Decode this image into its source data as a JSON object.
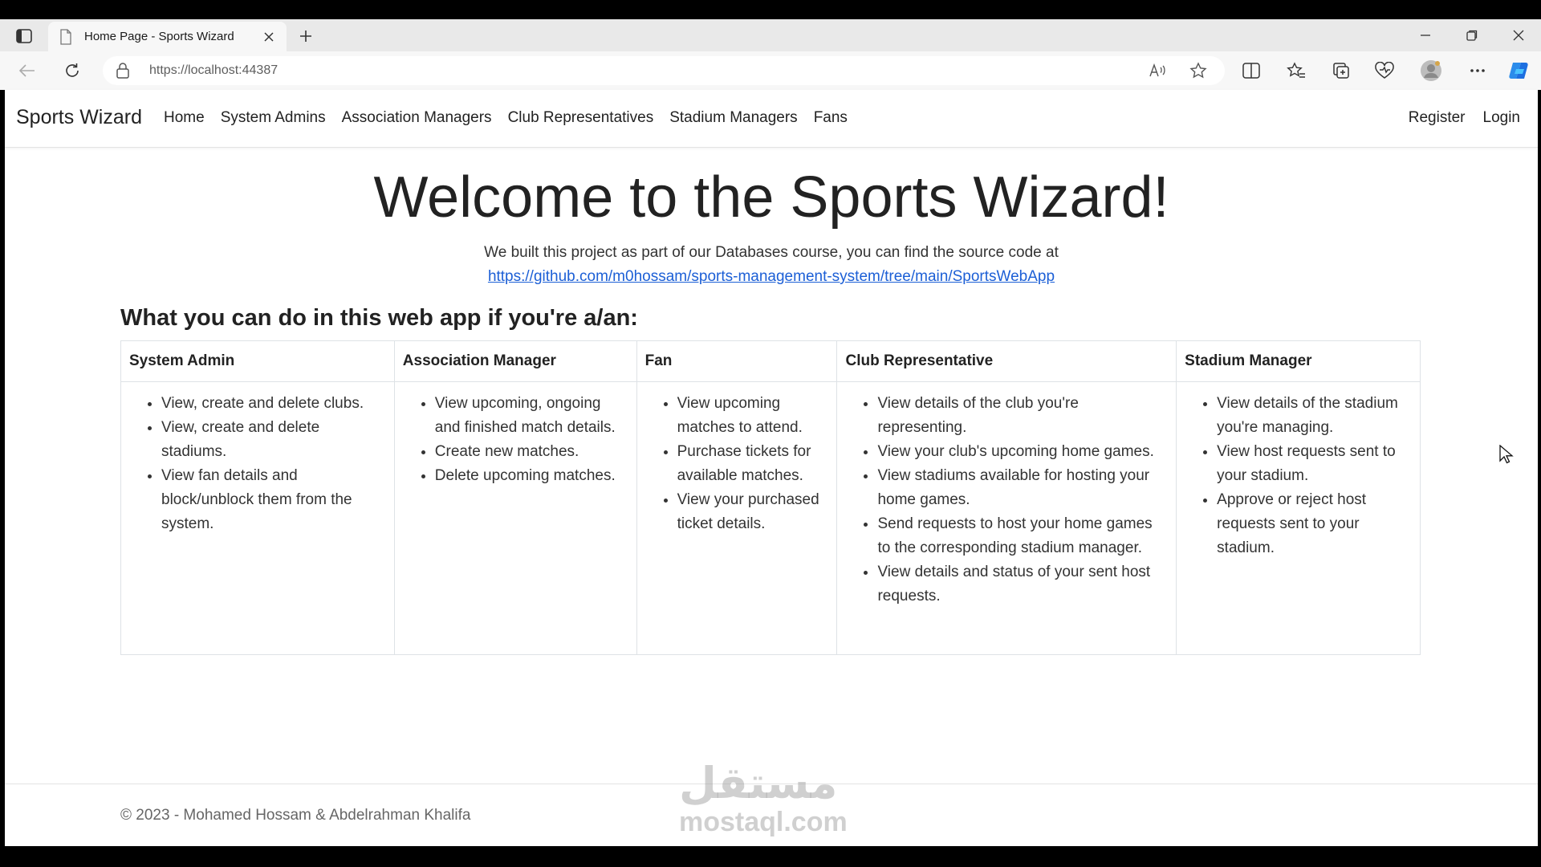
{
  "browser": {
    "tab_title": "Home Page - Sports Wizard",
    "url": "https://localhost:44387",
    "icons": [
      "tab-actions-icon",
      "page-favicon",
      "close-icon",
      "plus-icon",
      "minimize-icon",
      "restore-icon",
      "close-window-icon",
      "back-icon",
      "refresh-icon",
      "lock-icon",
      "read-aloud-icon",
      "favorite-star-icon",
      "split-screen-icon",
      "favorites-icon",
      "collections-icon",
      "browser-essentials-icon",
      "profile-icon",
      "more-icon",
      "copilot-icon"
    ]
  },
  "navbar": {
    "brand": "Sports Wizard",
    "links": [
      "Home",
      "System Admins",
      "Association Managers",
      "Club Representatives",
      "Stadium Managers",
      "Fans"
    ],
    "register": "Register",
    "login": "Login"
  },
  "hero": {
    "title": "Welcome to the Sports Wizard!",
    "subtitle": "We built this project as part of our Databases course, you can find the source code at",
    "link": "https://github.com/m0hossam/sports-management-system/tree/main/SportsWebApp"
  },
  "section": {
    "title": "What you can do in this web app if you're a/an:"
  },
  "roles": [
    {
      "name": "System Admin",
      "items": [
        "View, create and delete clubs.",
        "View, create and delete stadiums.",
        "View fan details and block/unblock them from the system."
      ]
    },
    {
      "name": "Association Manager",
      "items": [
        "View upcoming, ongoing and finished match details.",
        "Create new matches.",
        "Delete upcoming matches."
      ]
    },
    {
      "name": "Fan",
      "items": [
        "View upcoming matches to attend.",
        "Purchase tickets for available matches.",
        "View your purchased ticket details."
      ]
    },
    {
      "name": "Club Representative",
      "items": [
        "View details of the club you're representing.",
        "View your club's upcoming home games.",
        "View stadiums available for hosting your home games.",
        "Send requests to host your home games to the corresponding stadium manager.",
        "View details and status of your sent host requests."
      ]
    },
    {
      "name": "Stadium Manager",
      "items": [
        "View details of the stadium you're managing.",
        "View host requests sent to your stadium.",
        "Approve or reject host requests sent to your stadium."
      ]
    }
  ],
  "footer": {
    "copyright": "© 2023 - Mohamed Hossam & Abdelrahman Khalifa"
  },
  "watermark": {
    "arabic": "مستقل",
    "latin": "mostaql.com"
  }
}
